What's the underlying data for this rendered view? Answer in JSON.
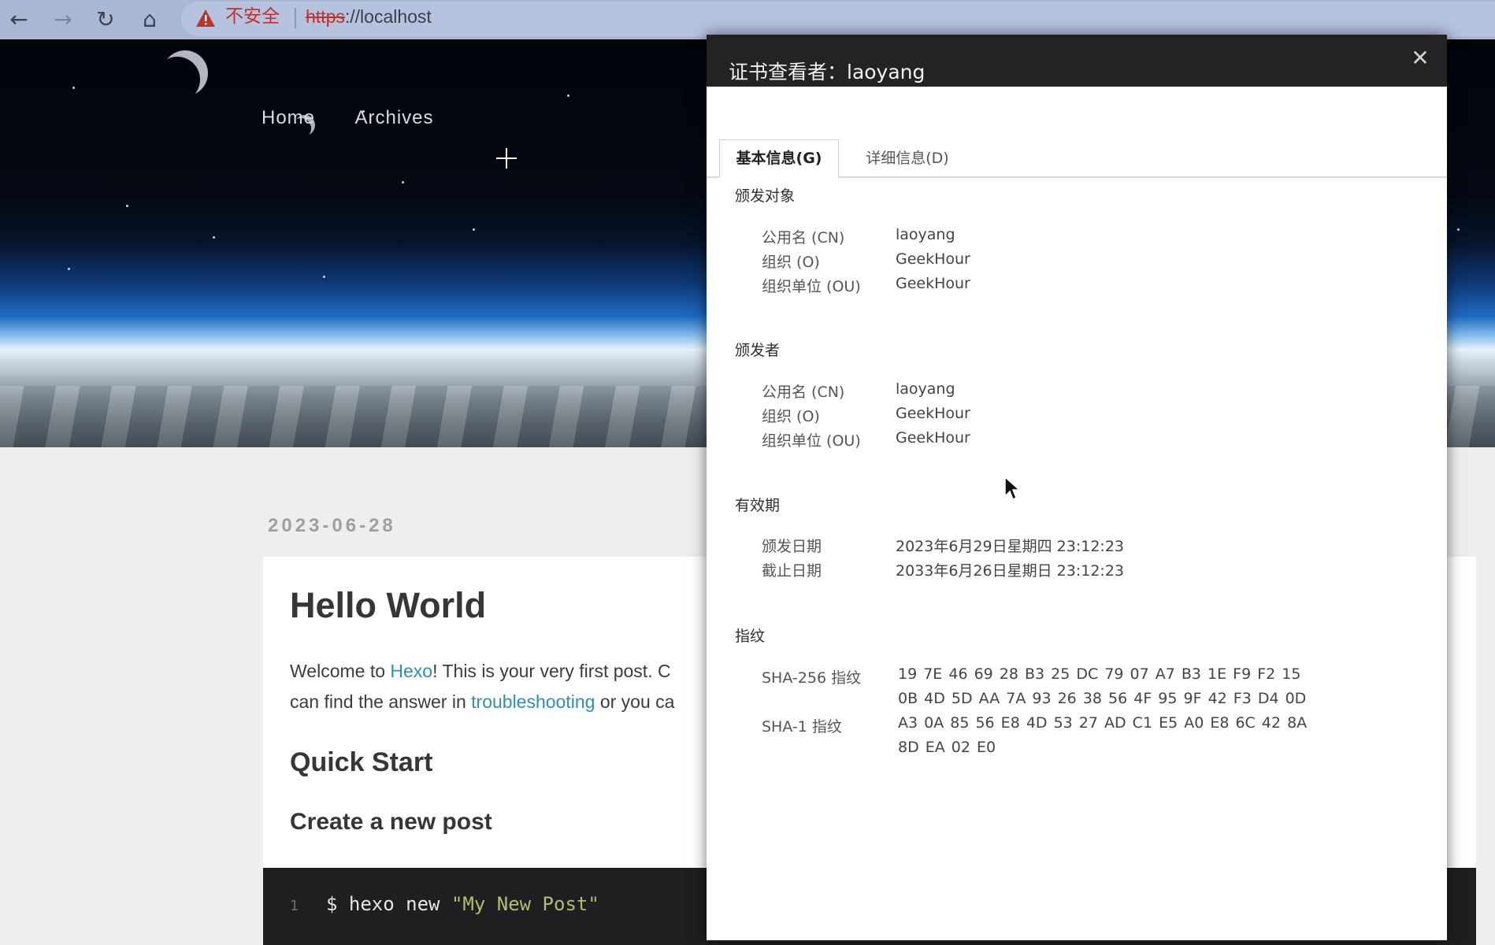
{
  "browser": {
    "security_label": "不安全",
    "url_scheme": "https",
    "url_rest": "://localhost"
  },
  "site_nav": [
    "Home",
    "Archives"
  ],
  "post": {
    "date": "2023-06-28",
    "title": "Hello World",
    "line1_before": "Welcome to ",
    "line1_link": "Hexo",
    "line1_after": "! This is your very first post. C",
    "line2_before": "can find the answer in ",
    "line2_link": "troubleshooting",
    "line2_after": " or you ca",
    "h2": "Quick Start",
    "h3": "Create a new post",
    "code_line_no": "1",
    "code_cmd": "$ hexo new ",
    "code_arg": "\"My New Post\""
  },
  "dialog": {
    "title": "证书查看者：laoyang",
    "close_glyph": "✕",
    "tabs": [
      "基本信息(G)",
      "详细信息(D)"
    ],
    "issued_to": {
      "title": "颁发对象",
      "rows": [
        {
          "key": "公用名 (CN)",
          "value": "laoyang"
        },
        {
          "key": "组织 (O)",
          "value": "GeekHour"
        },
        {
          "key": "组织单位 (OU)",
          "value": "GeekHour"
        }
      ]
    },
    "issued_by": {
      "title": "颁发者",
      "rows": [
        {
          "key": "公用名 (CN)",
          "value": "laoyang"
        },
        {
          "key": "组织 (O)",
          "value": "GeekHour"
        },
        {
          "key": "组织单位 (OU)",
          "value": "GeekHour"
        }
      ]
    },
    "validity": {
      "title": "有效期",
      "rows": [
        {
          "key": "颁发日期",
          "value": "2023年6月29日星期四 23:12:23"
        },
        {
          "key": "截止日期",
          "value": "2033年6月26日星期日 23:12:23"
        }
      ]
    },
    "fingerprints": {
      "title": "指纹",
      "sha256_key": "SHA-256 指纹",
      "sha256_line1": "19 7E 46 69 28 B3 25 DC 79 07 A7 B3 1E F9 F2 15",
      "sha256_line2": "0B 4D 5D AA 7A 93 26 38 56 4F 95 9F 42 F3 D4 0D",
      "sha1_key": "SHA-1 指纹",
      "sha1_line1": "A3 0A 85 56 E8 4D 53 27 AD C1 E5 A0 E8 6C 42 8A",
      "sha1_line2": "8D EA 02 E0"
    }
  }
}
